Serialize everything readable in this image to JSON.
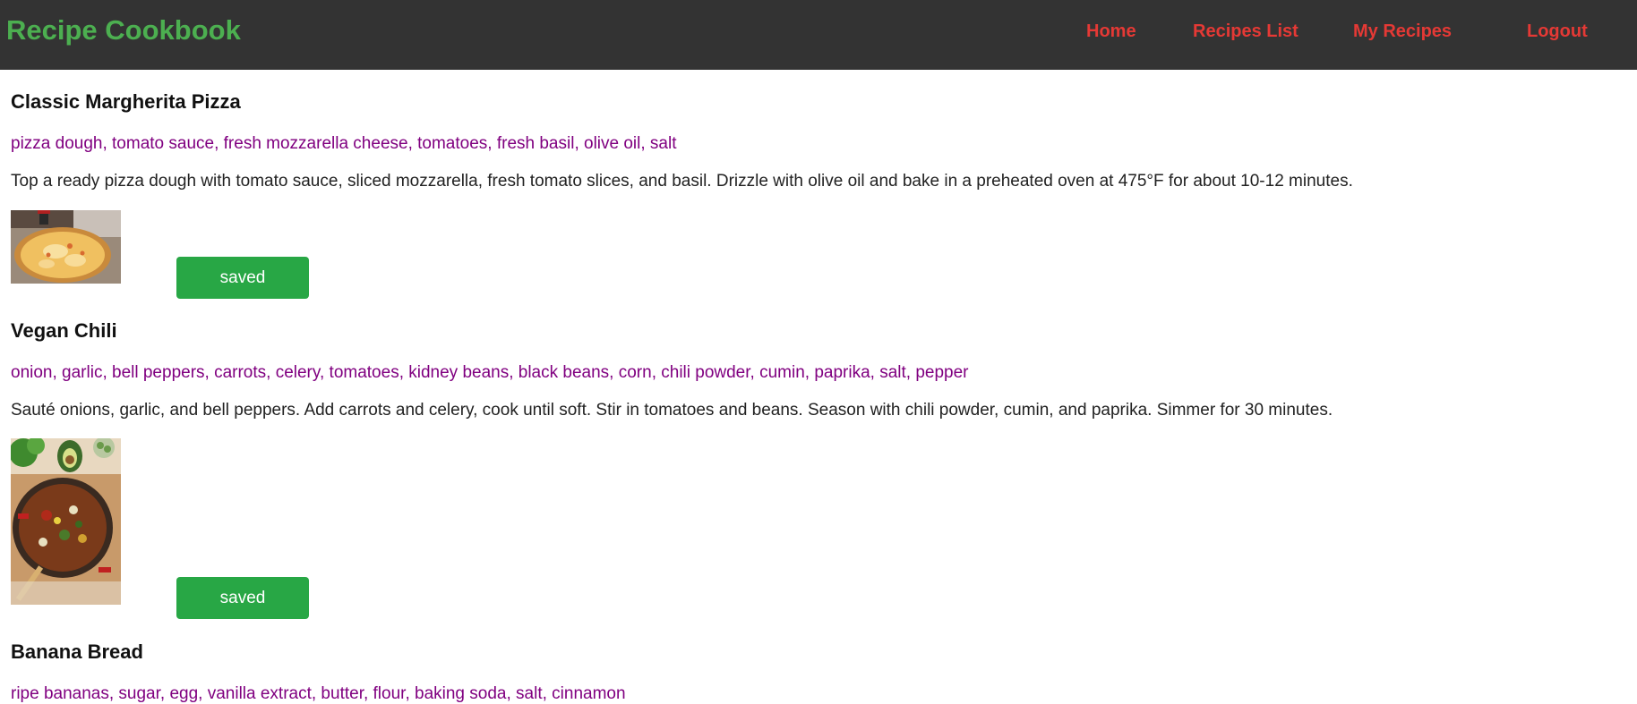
{
  "app": {
    "brand": "Recipe Cookbook"
  },
  "nav": {
    "home": "Home",
    "recipes_list": "Recipes List",
    "my_recipes": "My Recipes",
    "logout": "Logout"
  },
  "recipes": [
    {
      "title": "Classic Margherita Pizza",
      "ingredients": "pizza dough, tomato sauce, fresh mozzarella cheese, tomatoes, fresh basil, olive oil, salt",
      "instructions": "Top a ready pizza dough with tomato sauce, sliced mozzarella, fresh tomato slices, and basil. Drizzle with olive oil and bake in a preheated oven at 475°F for about 10-12 minutes.",
      "button_label": "saved",
      "image_icon": "pizza-image"
    },
    {
      "title": "Vegan Chili",
      "ingredients": "onion, garlic, bell peppers, carrots, celery, tomatoes, kidney beans, black beans, corn, chili powder, cumin, paprika, salt, pepper",
      "instructions": "Sauté onions, garlic, and bell peppers. Add carrots and celery, cook until soft. Stir in tomatoes and beans. Season with chili powder, cumin, and paprika. Simmer for 30 minutes.",
      "button_label": "saved",
      "image_icon": "chili-image"
    },
    {
      "title": "Banana Bread",
      "ingredients": "ripe bananas, sugar, egg, vanilla extract, butter, flour, baking soda, salt, cinnamon"
    }
  ],
  "colors": {
    "navbar_bg": "#333333",
    "brand": "#4caf50",
    "nav_link": "#e53935",
    "ingredients": "#800080",
    "button_bg": "#28a745",
    "button_text": "#ffffff"
  }
}
